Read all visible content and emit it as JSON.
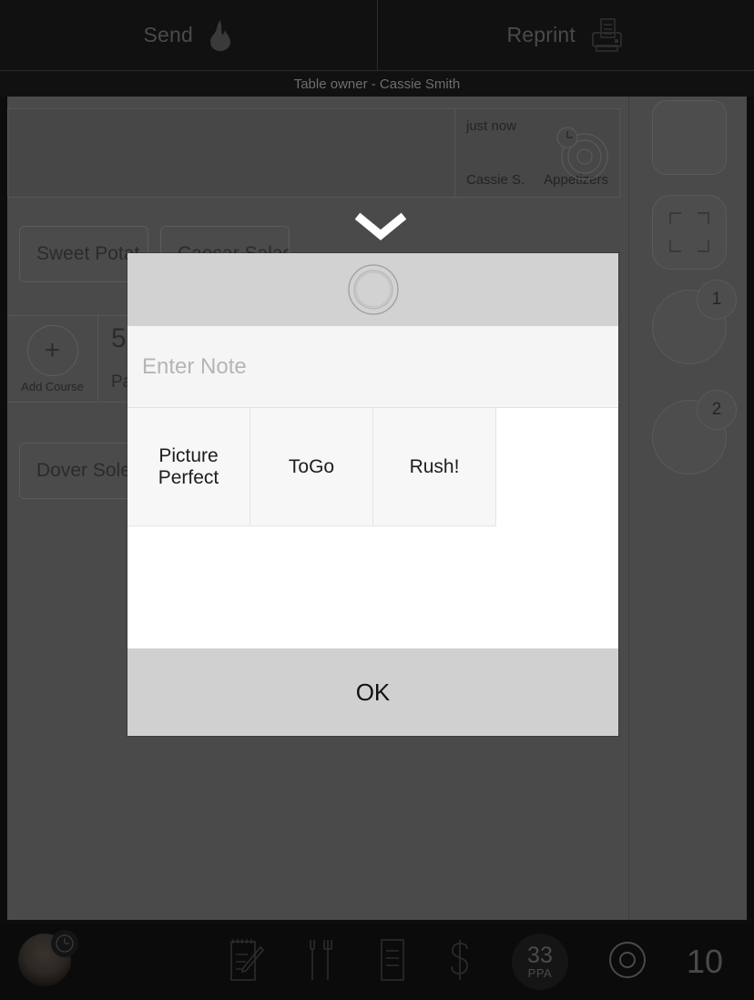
{
  "topbar": {
    "send_label": "Send",
    "send_icon": "flame-icon",
    "reprint_label": "Reprint",
    "reprint_icon": "printer-icon"
  },
  "owner_bar": {
    "text": "Table owner - Cassie Smith"
  },
  "order": {
    "course_card": {
      "timestamp": "just now",
      "server": "Cassie S.",
      "course": "Appetizers",
      "icon": "course-plate-icon",
      "badge_icon": "clock-icon"
    },
    "chips": [
      {
        "label": "Sweet Potat"
      },
      {
        "label": "Caesar Salad"
      },
      {
        "label": "Dover Sole F"
      }
    ],
    "add_course": {
      "label": "Add Course",
      "icon": "plus-icon"
    },
    "course_cell": {
      "title": "5",
      "subtitle": "Par"
    },
    "collapse_icon": "chevron-down-icon"
  },
  "sidebar": {
    "items": [
      {
        "name": "rounded-square",
        "icon": "rounded-square-icon",
        "badge": ""
      },
      {
        "name": "crop-select",
        "icon": "crop-select-icon",
        "badge": ""
      },
      {
        "name": "seat-1",
        "icon": "seat-circle-icon",
        "badge": "1"
      },
      {
        "name": "seat-2",
        "icon": "seat-circle-icon",
        "badge": "2"
      }
    ]
  },
  "modal": {
    "title_icon": "course-plate-icon",
    "note_placeholder": "Enter Note",
    "note_value": "",
    "quick_notes": [
      "Picture Perfect",
      "ToGo",
      "Rush!",
      ""
    ],
    "ok_label": "OK"
  },
  "bottombar": {
    "avatar": "user-avatar",
    "avatar_badge_icon": "clock-icon",
    "icons": [
      {
        "name": "notepad-edit-icon"
      },
      {
        "name": "forks-icon"
      },
      {
        "name": "receipt-icon"
      },
      {
        "name": "dollar-icon"
      }
    ],
    "ppa_value": "33",
    "ppa_label": "PPA",
    "circle_icon": "circle-target-icon",
    "guest_count": "10"
  },
  "colors": {
    "app_bg": "#0d0d0d",
    "content_bg": "#4a4a4a",
    "modal_bg": "#ffffff",
    "modal_head": "#d2d2d2",
    "modal_foot": "#d0d0d0"
  }
}
